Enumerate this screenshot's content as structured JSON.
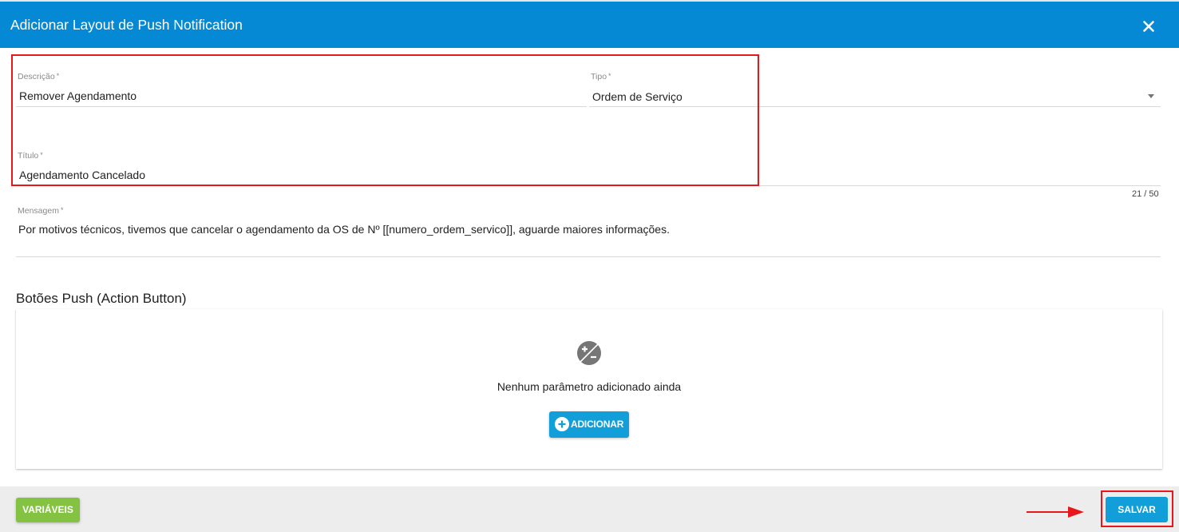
{
  "dialog": {
    "title": "Adicionar Layout de Push Notification",
    "close_icon": "close-icon"
  },
  "form": {
    "descricao": {
      "label": "Descrição",
      "required_mark": "*",
      "value": "Remover Agendamento"
    },
    "tipo": {
      "label": "Tipo",
      "required_mark": "*",
      "value": "Ordem de Serviço"
    },
    "titulo": {
      "label": "Título",
      "required_mark": "*",
      "value": "Agendamento Cancelado",
      "counter": "21 / 50"
    },
    "mensagem": {
      "label": "Mensagem",
      "required_mark": "*",
      "value": "Por motivos técnicos, tivemos que cancelar o agendamento da OS de Nº [[numero_ordem_servico]], aguarde maiores informações."
    }
  },
  "action_buttons": {
    "section_title": "Botões Push (Action Button)",
    "empty_icon": "plus-minus-icon",
    "empty_text": "Nenhum parâmetro adicionado ainda",
    "add_label": "ADICIONAR"
  },
  "footer": {
    "variables_label": "VARIÁVEIS",
    "save_label": "SALVAR"
  },
  "colors": {
    "header": "#0589d5",
    "primary_button": "#119ed9",
    "variables_button": "#84c341",
    "annotation": "#e8171c",
    "footer": "#ededed"
  }
}
